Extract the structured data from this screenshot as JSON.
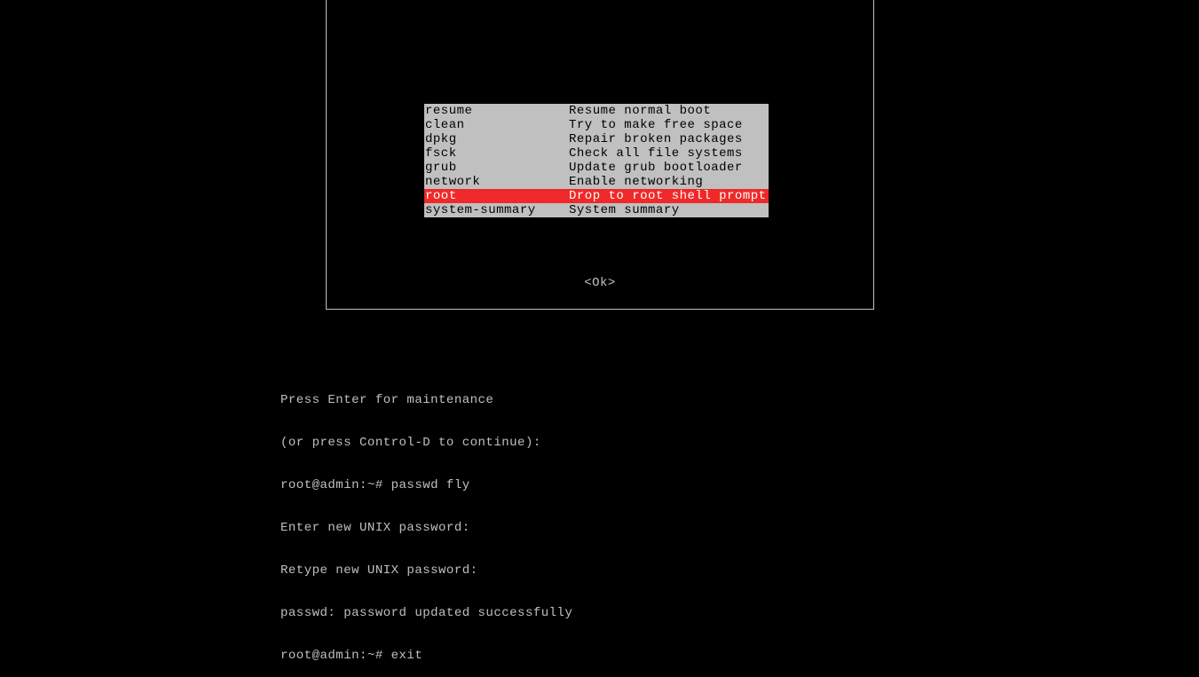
{
  "menu": {
    "items": [
      {
        "key": "resume",
        "desc": "Resume normal boot",
        "selected": false
      },
      {
        "key": "clean",
        "desc": "Try to make free space",
        "selected": false
      },
      {
        "key": "dpkg",
        "desc": "Repair broken packages",
        "selected": false
      },
      {
        "key": "fsck",
        "desc": "Check all file systems",
        "selected": false
      },
      {
        "key": "grub",
        "desc": "Update grub bootloader",
        "selected": false
      },
      {
        "key": "network",
        "desc": "Enable networking",
        "selected": false
      },
      {
        "key": "root",
        "desc": "Drop to root shell prompt",
        "selected": true
      },
      {
        "key": "system-summary",
        "desc": "System summary",
        "selected": false
      }
    ],
    "ok_label": "<Ok>"
  },
  "terminal": {
    "lines": [
      "Press Enter for maintenance",
      "(or press Control-D to continue):",
      "root@admin:~# passwd fly",
      "Enter new UNIX password:",
      "Retype new UNIX password:",
      "passwd: password updated successfully",
      "root@admin:~# exit"
    ]
  }
}
